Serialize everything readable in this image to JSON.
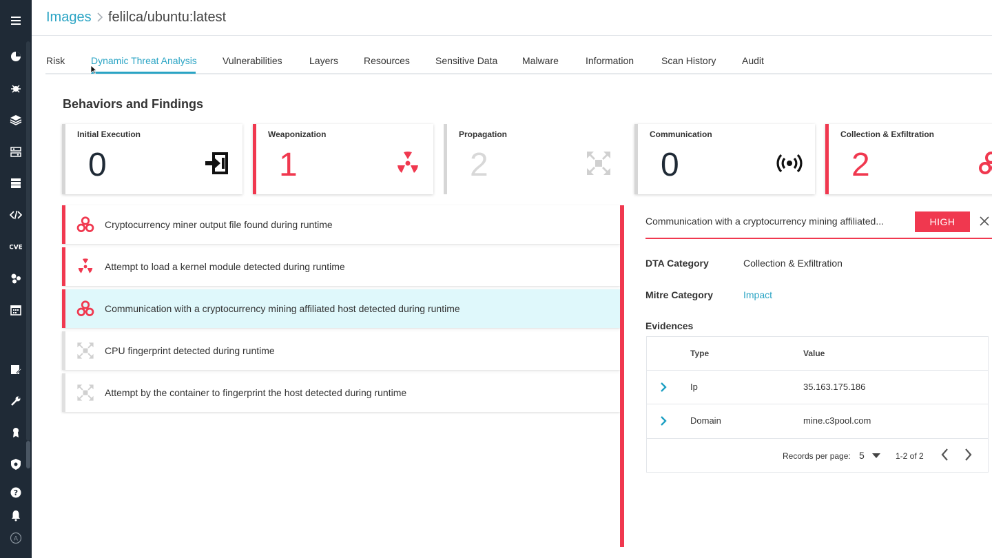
{
  "breadcrumb": {
    "root": "Images",
    "current": "felilca/ubuntu:latest"
  },
  "tabs": [
    {
      "label": "Risk"
    },
    {
      "label": "Dynamic Threat Analysis"
    },
    {
      "label": "Vulnerabilities"
    },
    {
      "label": "Layers"
    },
    {
      "label": "Resources"
    },
    {
      "label": "Sensitive Data"
    },
    {
      "label": "Malware"
    },
    {
      "label": "Information"
    },
    {
      "label": "Scan History"
    },
    {
      "label": "Audit"
    }
  ],
  "active_tab": "Dynamic Threat Analysis",
  "section_title": "Behaviors and Findings",
  "cards": [
    {
      "title": "Initial Execution",
      "count": "0",
      "icon": "enter-icon"
    },
    {
      "title": "Weaponization",
      "count": "1",
      "icon": "radiation-icon"
    },
    {
      "title": "Propagation",
      "count": "2",
      "icon": "spread-icon"
    },
    {
      "title": "Communication",
      "count": "0",
      "icon": "broadcast-icon"
    },
    {
      "title": "Collection & Exfiltration",
      "count": "2",
      "icon": "biohazard-icon"
    }
  ],
  "findings": [
    {
      "text": "Cryptocurrency miner output file found during runtime",
      "icon": "biohazard-icon"
    },
    {
      "text": "Attempt to load a kernel module detected during runtime",
      "icon": "radiation-icon"
    },
    {
      "text": "Communication with a cryptocurrency mining affiliated host detected during runtime",
      "icon": "biohazard-icon"
    },
    {
      "text": "CPU fingerprint detected during runtime",
      "icon": "spread-icon"
    },
    {
      "text": "Attempt by the container to fingerprint the host detected during runtime",
      "icon": "spread-icon"
    }
  ],
  "detail": {
    "title": "Communication with a cryptocurrency mining affiliated...",
    "severity": "HIGH",
    "dta_category_label": "DTA Category",
    "dta_category_value": "Collection & Exfiltration",
    "mitre_category_label": "Mitre Category",
    "mitre_category_value": "Impact",
    "evidences_label": "Evidences",
    "table": {
      "col_type": "Type",
      "col_value": "Value",
      "rows": [
        {
          "type": "Ip",
          "value": "35.163.175.186"
        },
        {
          "type": "Domain",
          "value": "mine.c3pool.com"
        }
      ],
      "records_per_page_label": "Records per page:",
      "records_per_page": "5",
      "range": "1-2 of 2"
    }
  },
  "colors": {
    "accent": "#2aa4c4",
    "danger": "#f0384f",
    "sidebar": "#1f2a36",
    "selected_row": "#dff8fb"
  }
}
